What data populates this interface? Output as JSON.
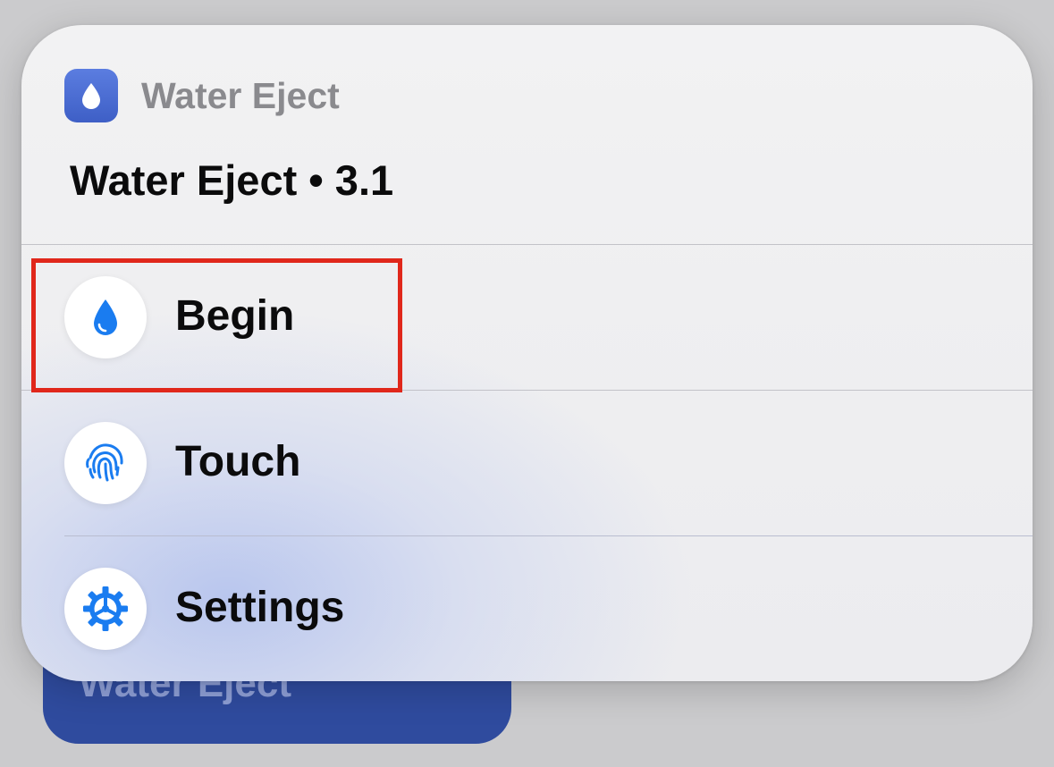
{
  "background_widget": {
    "label": "Water Eject",
    "color": "#2f4b9e"
  },
  "card": {
    "app_name": "Water Eject",
    "app_icon": "water-drop-icon",
    "title": "Water Eject • 3.1",
    "actions": [
      {
        "label": "Begin",
        "icon": "water-drop-icon",
        "highlighted": true
      },
      {
        "label": "Touch",
        "icon": "fingerprint-icon",
        "highlighted": false
      },
      {
        "label": "Settings",
        "icon": "gear-icon",
        "highlighted": false
      }
    ]
  },
  "colors": {
    "accent": "#1a7cf0",
    "highlight": "#e0271b",
    "app_icon": "#4a6bd4"
  }
}
